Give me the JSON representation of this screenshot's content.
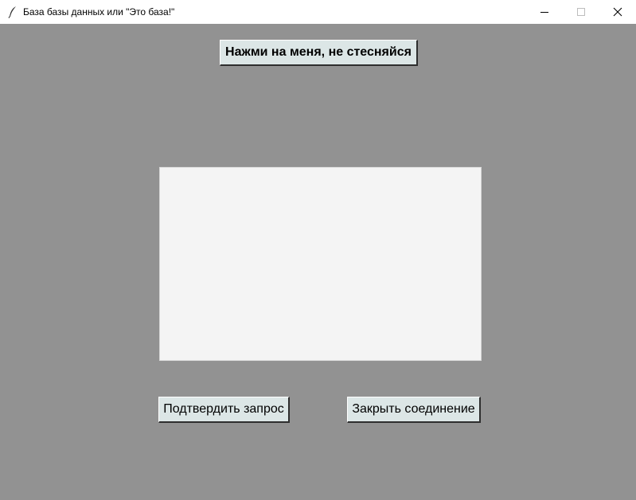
{
  "window": {
    "title": "База базы данных или \"Это база!\"",
    "icon": "feather-icon",
    "controls": {
      "minimize_icon": "minimize-icon",
      "maximize_icon": "maximize-icon",
      "close_icon": "close-icon"
    }
  },
  "main": {
    "top_button_label": "Нажми на меня, не стесняйся",
    "query_text": "",
    "confirm_button_label": "Подтвердить запрос",
    "close_connection_button_label": "Закрыть соединение"
  },
  "colors": {
    "background": "#929292",
    "button_face": "#dce6e6",
    "text_area_bg": "#f4f4f4",
    "titlebar_bg": "#ffffff"
  }
}
